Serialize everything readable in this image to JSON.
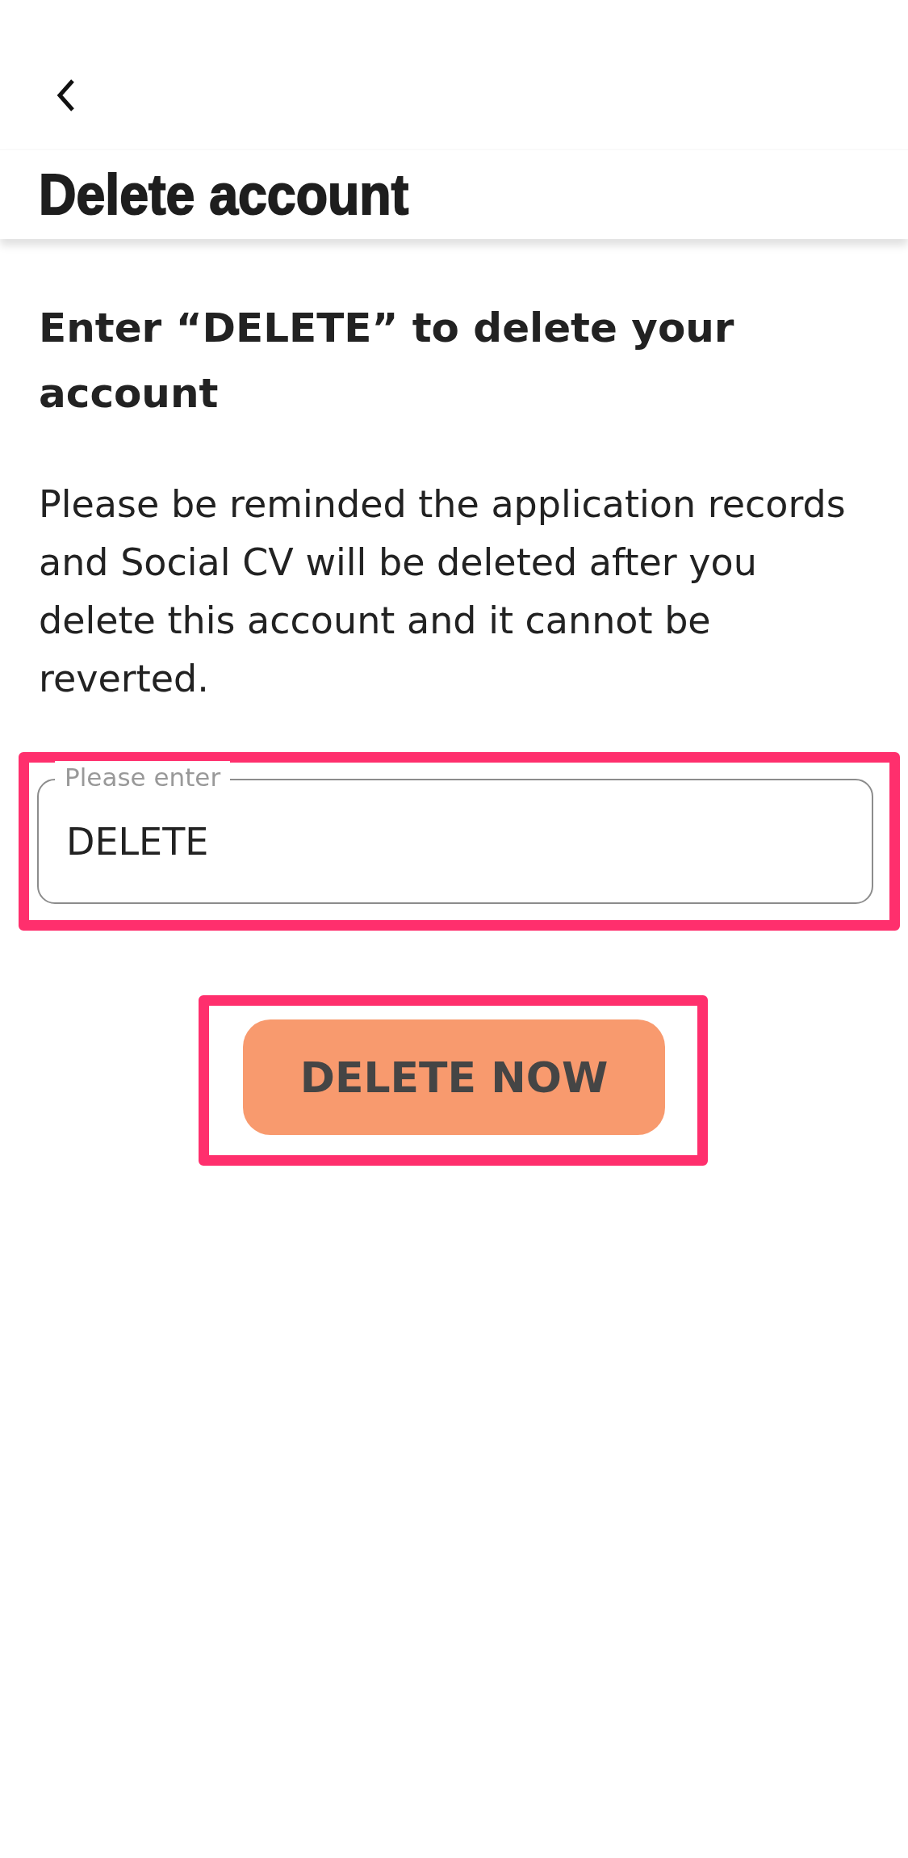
{
  "header": {
    "title": "Delete account"
  },
  "heading": "Enter “DELETE” to delete your account",
  "message": "Please be reminded the application records and Social CV will be deleted after you delete this account and it cannot be reverted.",
  "field": {
    "label": "Please enter",
    "value": "DELETE"
  },
  "button": {
    "label": "DELETE NOW"
  }
}
